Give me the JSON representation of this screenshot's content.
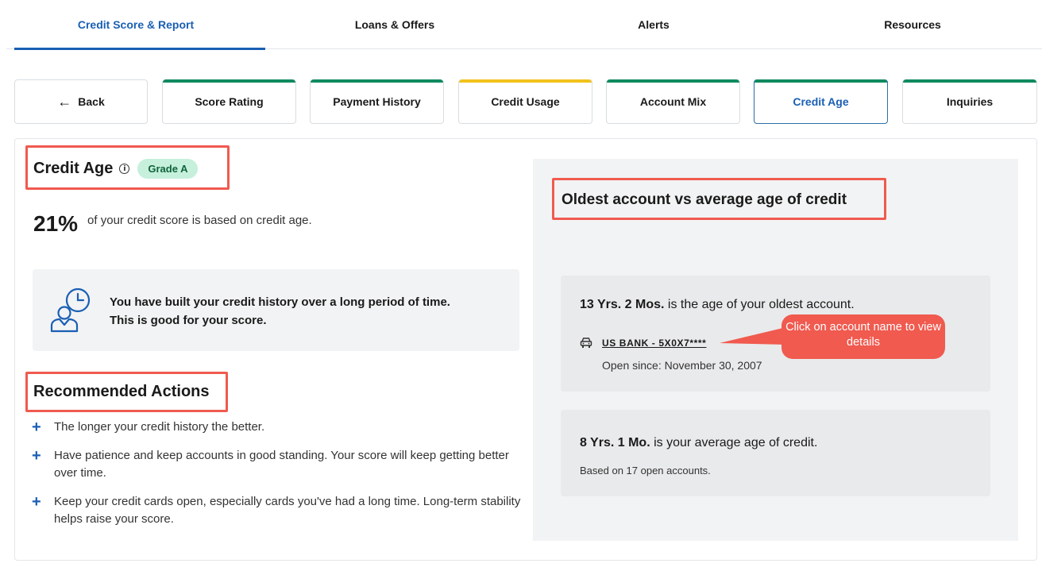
{
  "topnav": [
    {
      "label": "Credit Score & Report",
      "active": true
    },
    {
      "label": "Loans & Offers",
      "active": false
    },
    {
      "label": "Alerts",
      "active": false
    },
    {
      "label": "Resources",
      "active": false
    }
  ],
  "subtabs": {
    "back": "Back",
    "items": [
      {
        "label": "Score Rating",
        "color": "#0f8a5f"
      },
      {
        "label": "Payment History",
        "color": "#0f8a5f"
      },
      {
        "label": "Credit Usage",
        "color": "#f2c21b"
      },
      {
        "label": "Account Mix",
        "color": "#0f8a5f"
      },
      {
        "label": "Credit Age",
        "color": "#0f8a5f"
      },
      {
        "label": "Inquiries",
        "color": "#0f8a5f"
      }
    ]
  },
  "credit_age": {
    "title": "Credit Age",
    "grade": "Grade A",
    "percent": "21%",
    "percent_text": "of your credit score is based on credit age.",
    "history_line1": "You have built your credit history over a long period of time.",
    "history_line2": "This is good for your score."
  },
  "recommended": {
    "title": "Recommended Actions",
    "items": [
      "The longer your credit history the better.",
      "Have patience and keep accounts in good standing. Your score will keep getting better over time.",
      "Keep your credit cards open, especially cards you've had a long time. Long-term stability helps raise your score."
    ]
  },
  "oldest": {
    "title": "Oldest account vs average age of credit",
    "oldest_age": "13 Yrs. 2 Mos.",
    "oldest_text": " is the age of your oldest account.",
    "account_name": "US BANK - 5X0X7****",
    "open_since": "Open since: November 30, 2007",
    "avg_age": "8 Yrs. 1 Mo.",
    "avg_text": " is your average age of credit.",
    "based_on": "Based on 17 open accounts.",
    "callout": "Click on account name to view details"
  },
  "colors": {
    "highlight": "#f05a4f",
    "accent": "#1a5fb4"
  }
}
